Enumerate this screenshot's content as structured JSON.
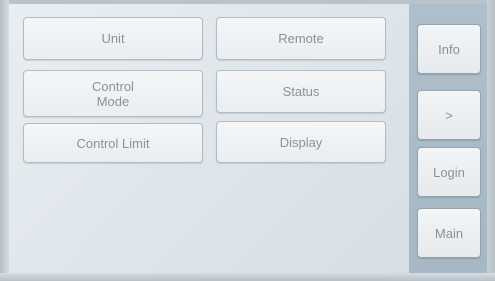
{
  "menu": {
    "left_column": [
      {
        "label": "Unit"
      },
      {
        "label": "Control\nMode"
      },
      {
        "label": "Control Limit"
      }
    ],
    "right_column": [
      {
        "label": "Remote"
      },
      {
        "label": "Status"
      },
      {
        "label": "Display"
      }
    ]
  },
  "sidebar": {
    "info_label": "Info",
    "next_label": ">",
    "login_label": "Login",
    "main_label": "Main"
  },
  "colors": {
    "button_text": "#8a9297",
    "sidebar_bg": "#a6b8c5",
    "screen_bg": "#dfe6eb"
  }
}
